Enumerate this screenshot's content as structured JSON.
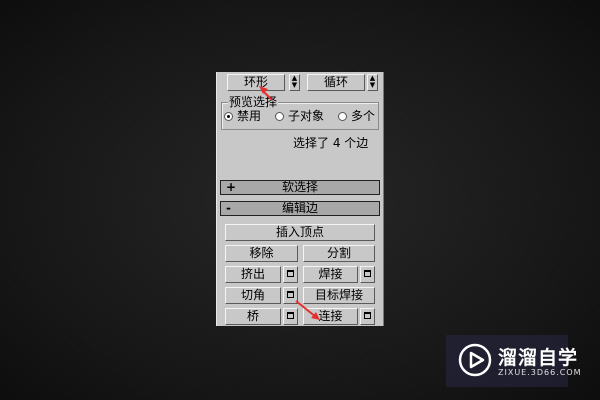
{
  "toolbar": {
    "ring_label": "环形",
    "loop_label": "循环"
  },
  "preview": {
    "title": "预览选择",
    "options": [
      {
        "label": "禁用",
        "selected": true
      },
      {
        "label": "子对象",
        "selected": false
      },
      {
        "label": "多个",
        "selected": false
      }
    ]
  },
  "status": "选择了 4 个边",
  "rollouts": {
    "soft_selection": {
      "sign": "+",
      "label": "软选择"
    },
    "edit_edges": {
      "sign": "-",
      "label": "编辑边"
    }
  },
  "buttons": {
    "insert_vertex": "插入顶点",
    "remove": "移除",
    "split": "分割",
    "extrude": "挤出",
    "weld": "焊接",
    "chamfer": "切角",
    "target_weld": "目标焊接",
    "bridge": "桥",
    "connect": "连接"
  },
  "watermark": {
    "name": "溜溜自学",
    "url": "ZIXUE.3D66.COM"
  },
  "colors": {
    "arrow": "#e53030",
    "panel": "#c8c8c8",
    "rollout": "#a8a8a8"
  }
}
